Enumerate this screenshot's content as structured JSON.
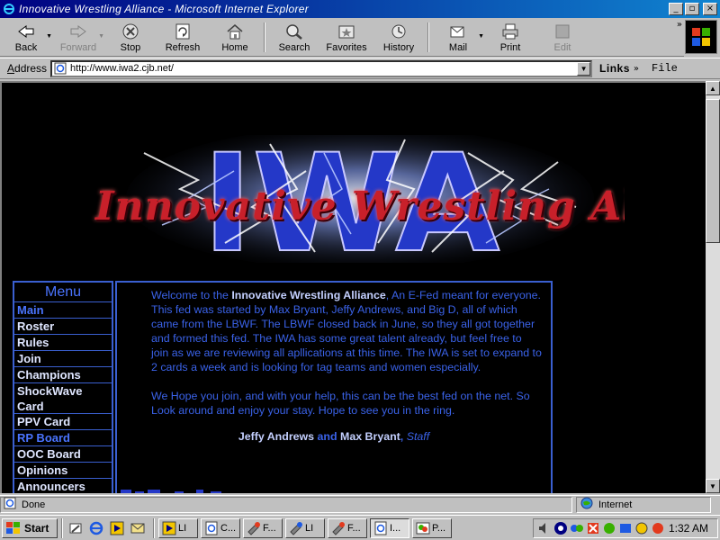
{
  "window": {
    "title": "Innovative Wrestling Alliance - Microsoft Internet Explorer",
    "controls": {
      "minimize": "_",
      "maximize": "▫",
      "close": "×"
    }
  },
  "toolbar": {
    "back": "Back",
    "forward": "Forward",
    "stop": "Stop",
    "refresh": "Refresh",
    "home": "Home",
    "search": "Search",
    "favorites": "Favorites",
    "history": "History",
    "mail": "Mail",
    "print": "Print",
    "edit": "Edit",
    "more": "»"
  },
  "address": {
    "label_first": "A",
    "label_rest": "ddress",
    "url": "http://www.iwa2.cjb.net/",
    "links": "Links",
    "links_more": "»",
    "file": "File"
  },
  "banner": {
    "logo_text": "Innovative Wrestling Alliance"
  },
  "menu": {
    "heading": "Menu",
    "items": [
      {
        "label": "Main",
        "color": "#4a74ff"
      },
      {
        "label": "Roster"
      },
      {
        "label": "Rules"
      },
      {
        "label": "Join"
      },
      {
        "label": "Champions"
      },
      {
        "label": "ShockWave Card"
      },
      {
        "label": "PPV Card"
      },
      {
        "label": "RP Board",
        "color": "#4a74ff"
      },
      {
        "label": "OOC Board"
      },
      {
        "label": "Opinions"
      },
      {
        "label": "Announcers"
      }
    ]
  },
  "main": {
    "p1_a": "Welcome to the ",
    "p1_b": "Innovative Wrestling Alliance",
    "p1_c": ", An E-Fed meant for everyone. This fed was started by Max Bryant, Jeffy Andrews, and Big D, all of which came from the LBWF. The LBWF closed back in June, so they all got together and formed this fed. The IWA has some great talent already, but feel free to join as we are reviewing all apllications at this time. The IWA is set to expand to 2 cards a week and is looking for tag teams and women especially.",
    "p2": "We Hope you join, and with your help, this can be the best fed on the net. So Look around and enjoy your stay. Hope to see you in the ring.",
    "sig_name1": "Jeffy Andrews",
    "sig_and": " and ",
    "sig_name2": "Max Bryant",
    "sig_comma": ", ",
    "sig_staff": "Staff"
  },
  "status": {
    "left": "Done",
    "zone": "Internet"
  },
  "taskbar": {
    "start": "Start",
    "tasks": [
      {
        "label": "L̷̷",
        "text": "LI",
        "active": false
      },
      {
        "label": "C...",
        "text": "C...",
        "active": false
      },
      {
        "label": "F...",
        "text": "F...",
        "active": false
      },
      {
        "label": "LI",
        "text": "LI",
        "active": false
      },
      {
        "label": "F...",
        "text": "F...",
        "active": false
      },
      {
        "label": "I...",
        "text": "I...",
        "active": true
      },
      {
        "label": "P...",
        "text": "P...",
        "active": false
      }
    ],
    "clock": "1:32 AM"
  },
  "colors": {
    "title_bar": "#000080",
    "page_bg": "#000000",
    "menu_border": "#3a5fd0",
    "text_blue": "#3a62e8",
    "banner_red": "#c8202a"
  }
}
